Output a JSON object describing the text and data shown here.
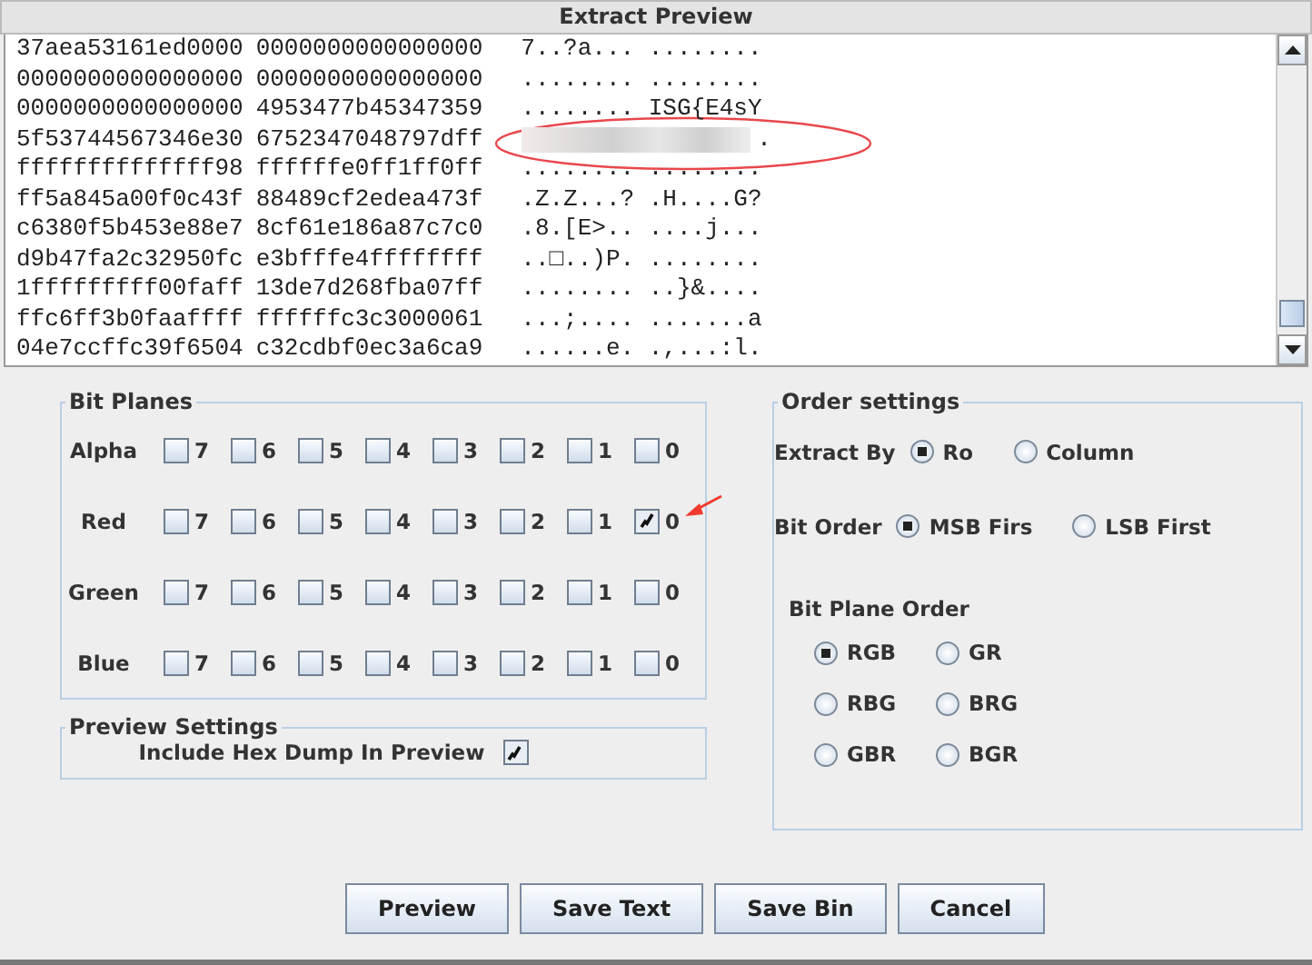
{
  "preview": {
    "title": "Extract Preview",
    "rows": [
      {
        "hex": [
          "37aea53161ed0000",
          "0000000000000000"
        ],
        "ascii": "7..?a... ........",
        "redacted": false
      },
      {
        "hex": [
          "0000000000000000",
          "0000000000000000"
        ],
        "ascii": "........ ........",
        "redacted": false
      },
      {
        "hex": [
          "0000000000000000",
          "4953477b45347359"
        ],
        "ascii": "........ ISG{E4sY",
        "redacted": false
      },
      {
        "hex": [
          "5f53744567346e30",
          "6752347048797dff"
        ],
        "ascii": ".",
        "redacted": true
      },
      {
        "hex": [
          "ffffffffffffff98",
          "ffffffe0ff1ff0ff"
        ],
        "ascii": "........ ........",
        "redacted": false
      },
      {
        "hex": [
          "ff5a845a00f0c43f",
          "88489cf2edea473f"
        ],
        "ascii": ".Z.Z...? .H....G?",
        "redacted": false
      },
      {
        "hex": [
          "c6380f5b453e88e7",
          "8cf61e186a87c7c0"
        ],
        "ascii": ".8.[E>.. ....j...",
        "redacted": false
      },
      {
        "hex": [
          "d9b47fa2c32950fc",
          "e3bfffe4ffffffff"
        ],
        "ascii": "..□..)P. ........",
        "redacted": false
      },
      {
        "hex": [
          "1fffffffff00faff",
          "13de7d268fba07ff"
        ],
        "ascii": "........ ..}&....",
        "redacted": false
      },
      {
        "hex": [
          "ffc6ff3b0faaffff",
          "ffffffc3c3000061"
        ],
        "ascii": "...;.... .......a",
        "redacted": false
      },
      {
        "hex": [
          "04e7ccffc39f6504",
          "c32cdbf0ec3a6ca9"
        ],
        "ascii": "......e. .,...:l.",
        "redacted": false
      }
    ]
  },
  "bit_planes": {
    "title": "Bit Planes",
    "channels": [
      {
        "name": "Alpha",
        "bits": [
          {
            "label": "7",
            "checked": false
          },
          {
            "label": "6",
            "checked": false
          },
          {
            "label": "5",
            "checked": false
          },
          {
            "label": "4",
            "checked": false
          },
          {
            "label": "3",
            "checked": false
          },
          {
            "label": "2",
            "checked": false
          },
          {
            "label": "1",
            "checked": false
          },
          {
            "label": "0",
            "checked": false
          }
        ]
      },
      {
        "name": "Red",
        "bits": [
          {
            "label": "7",
            "checked": false
          },
          {
            "label": "6",
            "checked": false
          },
          {
            "label": "5",
            "checked": false
          },
          {
            "label": "4",
            "checked": false
          },
          {
            "label": "3",
            "checked": false
          },
          {
            "label": "2",
            "checked": false
          },
          {
            "label": "1",
            "checked": false
          },
          {
            "label": "0",
            "checked": true
          }
        ]
      },
      {
        "name": "Green",
        "bits": [
          {
            "label": "7",
            "checked": false
          },
          {
            "label": "6",
            "checked": false
          },
          {
            "label": "5",
            "checked": false
          },
          {
            "label": "4",
            "checked": false
          },
          {
            "label": "3",
            "checked": false
          },
          {
            "label": "2",
            "checked": false
          },
          {
            "label": "1",
            "checked": false
          },
          {
            "label": "0",
            "checked": false
          }
        ]
      },
      {
        "name": "Blue",
        "bits": [
          {
            "label": "7",
            "checked": false
          },
          {
            "label": "6",
            "checked": false
          },
          {
            "label": "5",
            "checked": false
          },
          {
            "label": "4",
            "checked": false
          },
          {
            "label": "3",
            "checked": false
          },
          {
            "label": "2",
            "checked": false
          },
          {
            "label": "1",
            "checked": false
          },
          {
            "label": "0",
            "checked": false
          }
        ]
      }
    ]
  },
  "preview_settings": {
    "title": "Preview Settings",
    "label": "Include Hex Dump In Preview",
    "checked": true
  },
  "order_settings": {
    "title": "Order settings",
    "extract_by": {
      "label": "Extract By",
      "options": [
        {
          "label": "Ro",
          "selected": true
        },
        {
          "label": "Column",
          "selected": false
        }
      ]
    },
    "bit_order": {
      "label": "Bit Order",
      "options": [
        {
          "label": "MSB Firs",
          "selected": true
        },
        {
          "label": "LSB First",
          "selected": false
        }
      ]
    },
    "bit_plane_order": {
      "label": "Bit Plane Order",
      "options": [
        {
          "label": "RGB",
          "selected": true
        },
        {
          "label": "GR",
          "selected": false
        },
        {
          "label": "RBG",
          "selected": false
        },
        {
          "label": "BRG",
          "selected": false
        },
        {
          "label": "GBR",
          "selected": false
        },
        {
          "label": "BGR",
          "selected": false
        }
      ]
    }
  },
  "buttons": [
    "Preview",
    "Save Text",
    "Save Bin",
    "Cancel"
  ]
}
